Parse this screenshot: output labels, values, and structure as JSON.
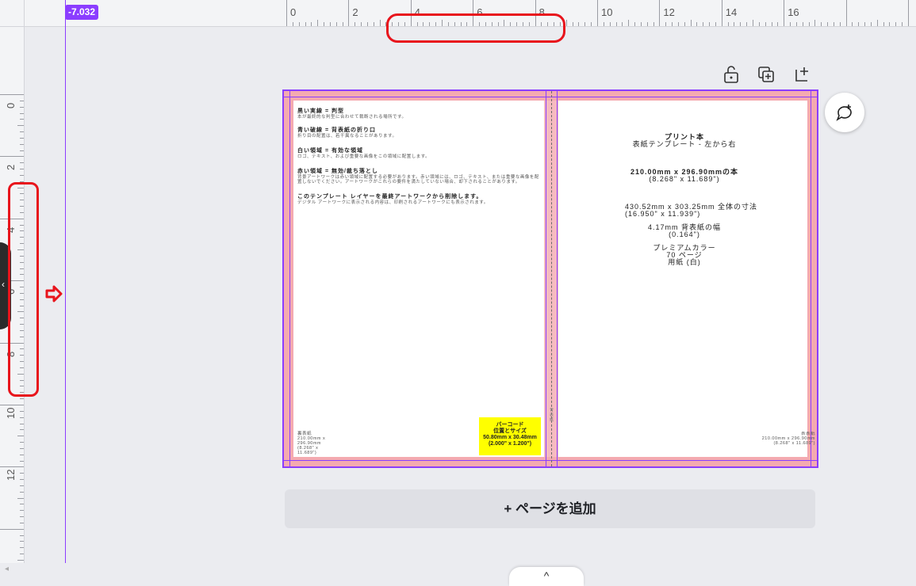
{
  "ruler": {
    "top_labels": [
      "0",
      "2",
      "4",
      "6",
      "8",
      "10",
      "12",
      "14",
      "16"
    ],
    "left_labels": [
      "0",
      "2",
      "4",
      "6",
      "8",
      "10",
      "12"
    ],
    "guide_value": "-7.032"
  },
  "toolbar": {
    "lock_icon": "unlock-icon",
    "duplicate_icon": "duplicate-page-icon",
    "add_icon": "add-page-icon"
  },
  "page": {
    "left": {
      "sections": [
        {
          "title": "黒い実線 = 判型",
          "body": "本が最終的な判型に合わせて裁断される場所です。"
        },
        {
          "title": "青い破線 = 背表紙の折り口",
          "body": "折り目の配置は、若干異なることがあります。"
        },
        {
          "title": "白い領域 = 有効な領域",
          "body": "ロゴ、テキスト、および重要な画像をこの領域に配置します。"
        },
        {
          "title": "赤い領域 = 無効/裁ち落とし",
          "body": "背景アートワークは赤い領域に配置する必要があります。赤い領域には、ロゴ、テキスト、または重要な画像を配置しないでください。アートワークがこれらの要件を満たしていない場合、却下されることがあります。"
        },
        {
          "title": "このテンプレート レイヤーを最終アートワークから削除します。",
          "body": "デジタル アートワークに表示される内容は、印刷されるアートワークにも表示されます。"
        }
      ],
      "footer": [
        "裏表紙",
        "210.00mm x",
        "296.90mm",
        "(8.268\" x",
        "11.689\")"
      ]
    },
    "barcode": {
      "line1": "バーコード",
      "line2": "位置とサイズ",
      "line3": "50.80mm x 30.48mm",
      "line4": "(2.000\" x 1.200\")"
    },
    "spine_label": "背表紙",
    "right": {
      "title1": "プリント本",
      "title2": "表紙テンプレート - 左から右",
      "size1": "210.00mm x 296.90mmの本",
      "size1b": "(8.268\" x 11.689\")",
      "size2": "430.52mm x 303.25mm 全体の寸法",
      "size2b": "(16.950\" x 11.939\")",
      "spine1": "4.17mm 背表紙の幅",
      "spine1b": "(0.164\")",
      "paper1": "プレミアムカラー",
      "paper2": "70 ページ",
      "paper3": "用紙 (白)",
      "footer1": "表表紙",
      "footer2": "210.00mm x 296.90mm",
      "footer3": "(8.268\" x 11.689\")"
    }
  },
  "add_page_label": "+ ページを追加",
  "bottom_tab_icon": "^",
  "colors": {
    "accent": "#8b3dff",
    "bleed": "#f4aab0",
    "annotation": "#e8141c",
    "barcode": "#ffff00"
  }
}
